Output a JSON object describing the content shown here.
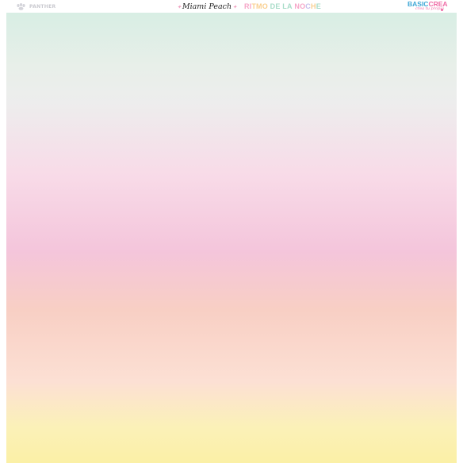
{
  "header": {
    "left_logo": {
      "text": "PANTHER",
      "icon": "paw-icon",
      "color": "#c9c9cf"
    },
    "product_name": "Miami Peach",
    "collection_name": "RITMO DE LA NOCHE",
    "collection_letter_colors": [
      "#f6a6c8",
      "#f6a6c8",
      "#f9cf8f",
      "#f9cf8f",
      "#f9cf8f",
      "#a8dcc8",
      "#a8dcc8",
      "#a8dcc8",
      "#a8dcc8",
      "#f6a6c8",
      "#f6a6c8",
      "#c8c0ec",
      "#f9cf8f",
      "#a8dcc8",
      "#a8dcc8",
      "#f6a6c8",
      "#c8c0ec"
    ],
    "brand": {
      "part1": "BASIC",
      "part2": "CREA",
      "tagline": "crea tu propia",
      "color_primary": "#3fa7d6",
      "color_secondary": "#ef6aa5"
    }
  },
  "swatch": {
    "gradient_colors": [
      "#d8eee4",
      "#ededed",
      "#f8dbe8",
      "#f4c5db",
      "#f8cfc4",
      "#fce0d4",
      "#fbf0a6"
    ]
  }
}
